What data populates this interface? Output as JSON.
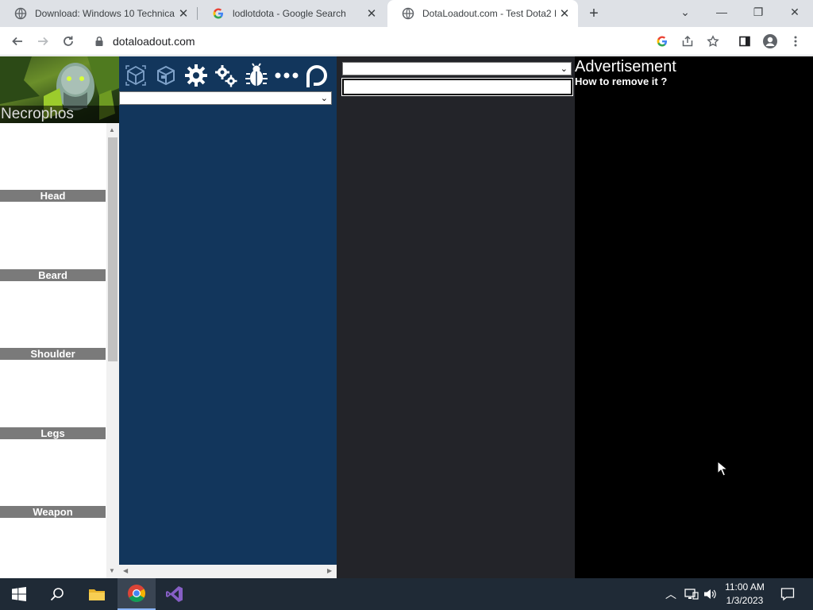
{
  "browser": {
    "tabs": [
      {
        "title": "Download: Windows 10 Technica",
        "active": false
      },
      {
        "title": "lodlotdota - Google Search",
        "active": false
      },
      {
        "title": "DotaLoadout.com - Test Dota2 Ic",
        "active": true
      }
    ],
    "new_tab": "+",
    "url": "dotaloadout.com",
    "window_controls": {
      "minimize": "—",
      "restore": "❐",
      "close": "✕",
      "tab_search": "⌄"
    }
  },
  "page": {
    "hero": {
      "name": "Necrophos"
    },
    "slots": [
      {
        "label": "Head"
      },
      {
        "label": "Beard"
      },
      {
        "label": "Shoulder"
      },
      {
        "label": "Legs"
      },
      {
        "label": "Weapon"
      }
    ],
    "toolbar_icons": [
      "cube-outline-icon",
      "box-icon",
      "gear-icon",
      "gears-icon",
      "bug-icon",
      "more-icon",
      "patreon-icon"
    ],
    "left_select": {
      "value": ""
    },
    "right_select": {
      "value": ""
    },
    "search": {
      "value": "",
      "placeholder": ""
    },
    "ad": {
      "title": "Advertisement",
      "subtitle": "How to remove it ?"
    }
  },
  "taskbar": {
    "time": "11:00 AM",
    "date": "1/3/2023"
  },
  "colors": {
    "blue_panel": "#12365c",
    "dark_panel": "#232429",
    "slot_label_bg": "#7a7a7a"
  }
}
